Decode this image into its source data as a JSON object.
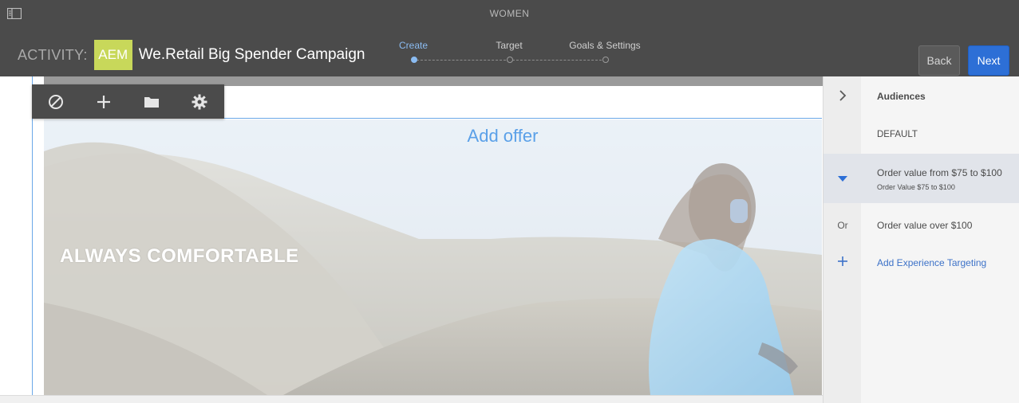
{
  "header": {
    "page_label": "WOMEN",
    "activity_label": "ACTIVITY:",
    "badge": "AEM",
    "activity_name": "We.Retail Big Spender Campaign",
    "steps": [
      {
        "label": "Create",
        "active": true
      },
      {
        "label": "Target",
        "active": false
      },
      {
        "label": "Goals & Settings",
        "active": false
      }
    ],
    "back_label": "Back",
    "next_label": "Next"
  },
  "editor": {
    "add_offer": "Add offer",
    "headline": "ALWAYS COMFORTABLE",
    "toolbar_icons": [
      "disable-icon",
      "add-icon",
      "folder-icon",
      "gear-icon"
    ]
  },
  "audiences": {
    "title": "Audiences",
    "default_label": "DEFAULT",
    "items": [
      {
        "label": "Order value from $75 to $100",
        "sublabel": "Order Value $75 to $100",
        "selected": true
      },
      {
        "prefix": "Or",
        "label": "Order value over $100"
      }
    ],
    "add_label": "Add Experience Targeting"
  },
  "colors": {
    "header_bg": "#4b4b4b",
    "accent_blue": "#2d6fd6",
    "active_step": "#8bbcf2",
    "badge_green": "#c8d85a",
    "offer_blue": "#5aa0e8"
  }
}
